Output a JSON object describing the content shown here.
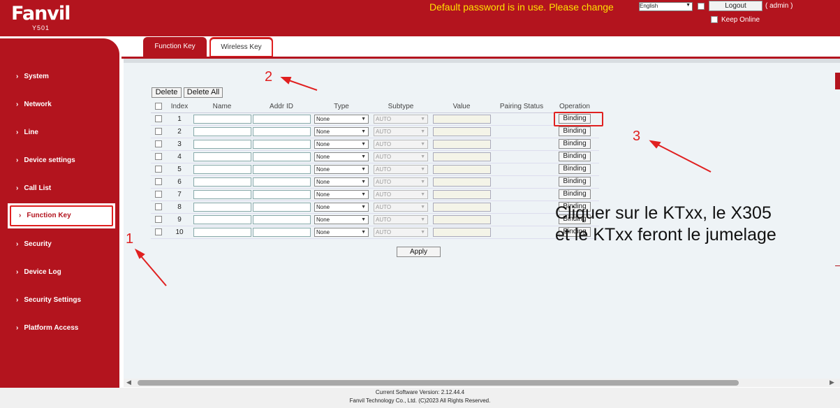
{
  "header": {
    "logo": "Fanvil",
    "model": "Y501",
    "warning": "Default password is in use. Please change",
    "language": "English",
    "logout_label": "Logout",
    "user": "( admin )",
    "keep_online": "Keep Online"
  },
  "sidebar": {
    "items": [
      {
        "label": "System"
      },
      {
        "label": "Network"
      },
      {
        "label": "Line"
      },
      {
        "label": "Device settings"
      },
      {
        "label": "Call List"
      },
      {
        "label": "Function Key"
      },
      {
        "label": "Security"
      },
      {
        "label": "Device Log"
      },
      {
        "label": "Security Settings"
      },
      {
        "label": "Platform Access"
      }
    ],
    "active": "Function Key"
  },
  "tabs": [
    {
      "label": "Function Key"
    },
    {
      "label": "Wireless Key"
    }
  ],
  "toolbar": {
    "delete_label": "Delete",
    "delete_all_label": "Delete All"
  },
  "table": {
    "columns": [
      "Index",
      "Name",
      "Addr ID",
      "Type",
      "Subtype",
      "Value",
      "Pairing Status",
      "Operation"
    ],
    "rows": [
      {
        "index": "1",
        "type": "None",
        "subtype": "AUTO",
        "operation": "Binding"
      },
      {
        "index": "2",
        "type": "None",
        "subtype": "AUTO",
        "operation": "Binding"
      },
      {
        "index": "3",
        "type": "None",
        "subtype": "AUTO",
        "operation": "Binding"
      },
      {
        "index": "4",
        "type": "None",
        "subtype": "AUTO",
        "operation": "Binding"
      },
      {
        "index": "5",
        "type": "None",
        "subtype": "AUTO",
        "operation": "Binding"
      },
      {
        "index": "6",
        "type": "None",
        "subtype": "AUTO",
        "operation": "Binding"
      },
      {
        "index": "7",
        "type": "None",
        "subtype": "AUTO",
        "operation": "Binding"
      },
      {
        "index": "8",
        "type": "None",
        "subtype": "AUTO",
        "operation": "Binding"
      },
      {
        "index": "9",
        "type": "None",
        "subtype": "AUTO",
        "operation": "Binding"
      },
      {
        "index": "10",
        "type": "None",
        "subtype": "AUTO",
        "operation": "Binding"
      }
    ]
  },
  "apply_label": "Apply",
  "footer": {
    "version": "Current Software Version: 2.12.44.4",
    "copyright": "Fanvil Technology Co., Ltd. (C)2023 All Rights Reserved."
  },
  "annotations": {
    "step1": "1",
    "step2": "2",
    "step3": "3",
    "note_line1": "Cliquer sur le KTxx, le X305",
    "note_line2": "et le KTxx feront le jumelage"
  },
  "colors": {
    "brand_red": "#b3141e",
    "warning_yellow": "#ffe100",
    "annotation_red": "#e02020"
  }
}
